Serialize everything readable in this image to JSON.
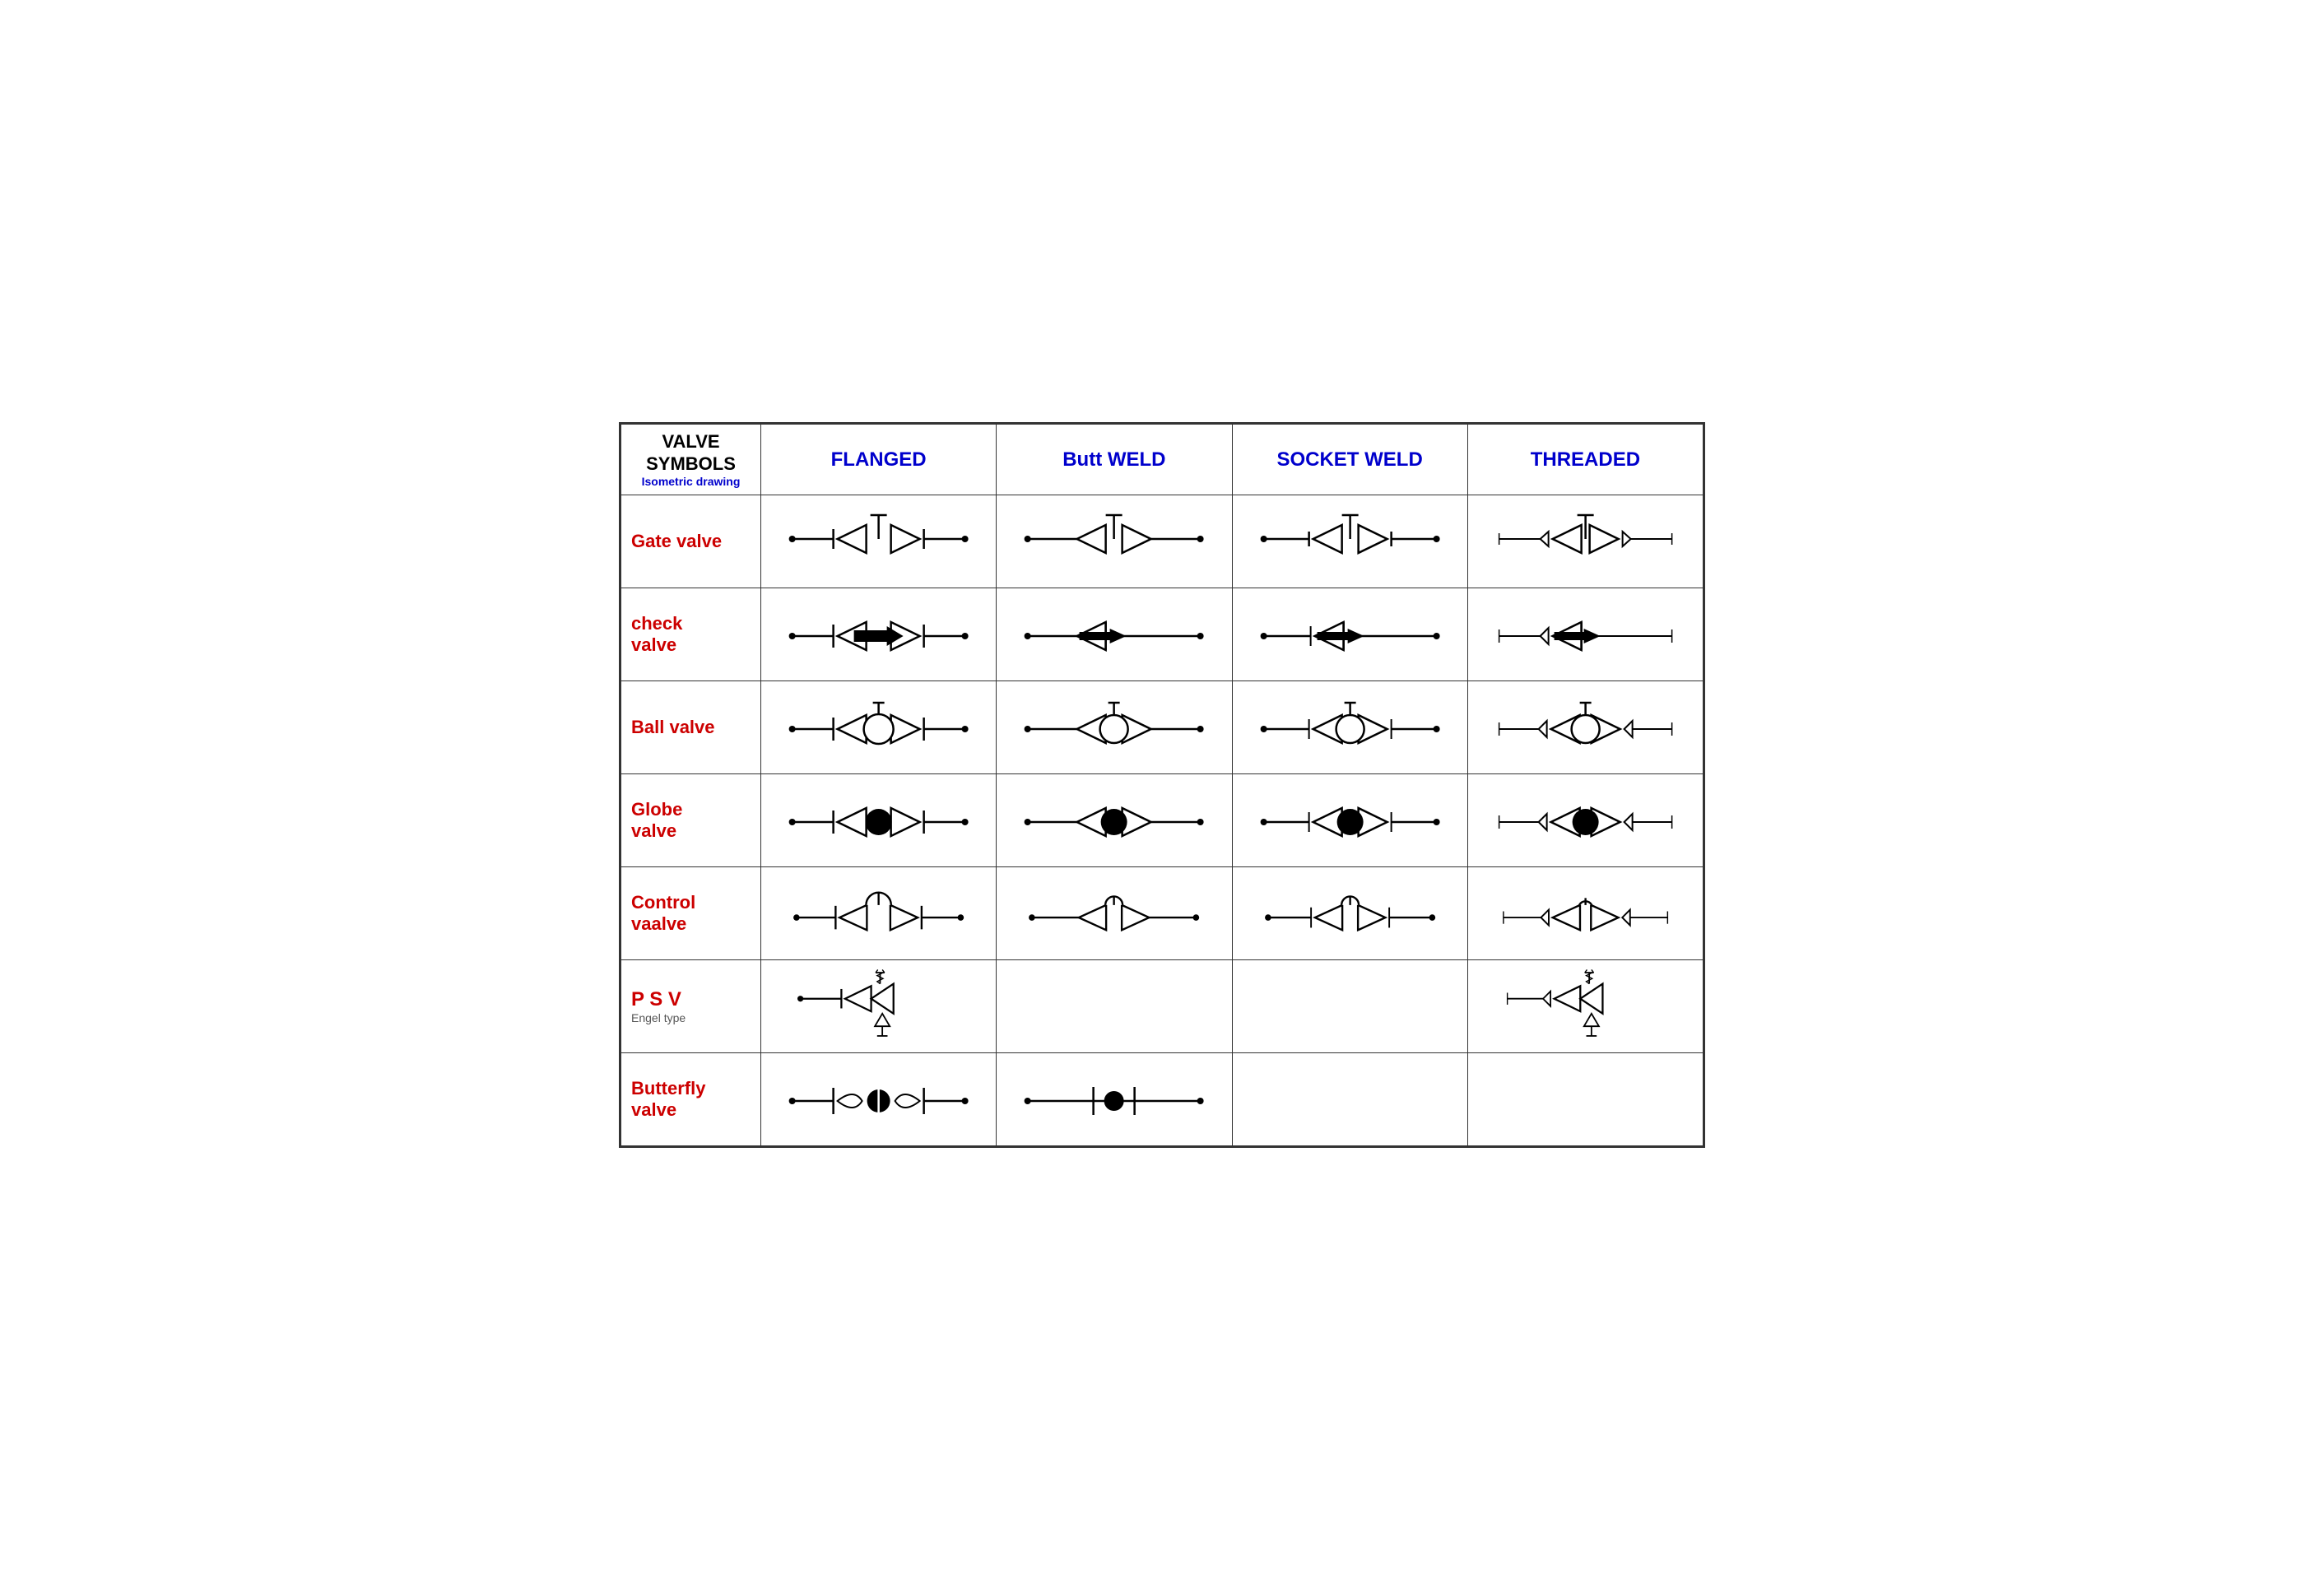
{
  "header": {
    "first_cell_title": "VALVE SYMBOLS",
    "first_cell_subtitle": "Isometric drawing",
    "columns": [
      "FLANGED",
      "Butt WELD",
      "SOCKET WELD",
      "THREADED"
    ]
  },
  "rows": [
    {
      "label": "Gate valve",
      "sub": ""
    },
    {
      "label": "check valve",
      "sub": ""
    },
    {
      "label": "Ball valve",
      "sub": ""
    },
    {
      "label": "Globe valve",
      "sub": ""
    },
    {
      "label": "Control vaalve",
      "sub": ""
    },
    {
      "label": "P S V",
      "sub": "Engel type"
    },
    {
      "label": "Butterfly valve",
      "sub": ""
    }
  ],
  "colors": {
    "header_blue": "#0000cc",
    "label_red": "#cc0000",
    "border": "#333"
  }
}
